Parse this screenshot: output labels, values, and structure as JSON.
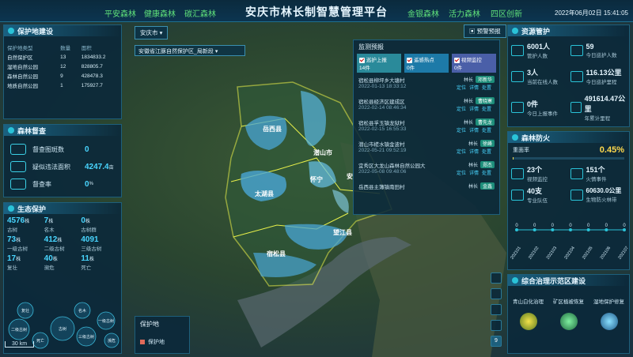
{
  "header": {
    "title": "安庆市林长制智慧管理平台",
    "nav_left": [
      "平安森林",
      "健康森林",
      "碳汇森林"
    ],
    "nav_right": [
      "金银森林",
      "活力森林",
      "四区创新"
    ],
    "clock": "2022年06月02日 15:41:05"
  },
  "map": {
    "city_select": "安庆市",
    "breadcrumb": "安徽省江豚自然保护区_局新段",
    "warning_button": "预警预报",
    "labels": {
      "yuexi": "岳西县",
      "qianshan": "潜山市",
      "taihu": "太湖县",
      "huaining": "怀宁",
      "susong": "宿松县",
      "wangjiang": "望江县",
      "aq": "安"
    },
    "scale": "30 km",
    "page_badge": "9"
  },
  "protect": {
    "title": "保护地建设",
    "headers": [
      "保护地类型",
      "数量",
      "面积"
    ],
    "rows": [
      [
        "自然保护区",
        "13",
        "1834833.2"
      ],
      [
        "湿地自然公园",
        "12",
        "828805.7"
      ],
      [
        "森林自然公园",
        "9",
        "428478.3"
      ],
      [
        "地质自然公园",
        "1",
        "175927.7"
      ]
    ]
  },
  "forest_check": {
    "title": "森林督查",
    "items": [
      {
        "label": "督查图斑数",
        "value": "0",
        "unit": ""
      },
      {
        "label": "疑似违法面积",
        "value": "4247.4",
        "unit": "亩"
      },
      {
        "label": "督查率",
        "value": "0",
        "unit": "%"
      }
    ]
  },
  "ecology": {
    "title": "生态保护",
    "stats": [
      {
        "value": "4576",
        "unit": "株",
        "label": "古树"
      },
      {
        "value": "7",
        "unit": "株",
        "label": "名木"
      },
      {
        "value": "0",
        "unit": "株",
        "label": "古树群"
      },
      {
        "value": "73",
        "unit": "株",
        "label": "一级古树"
      },
      {
        "value": "412",
        "unit": "株",
        "label": "二级古树"
      },
      {
        "value": "4091",
        "unit": "",
        "label": "三级古树"
      },
      {
        "value": "17",
        "unit": "株",
        "label": "复壮"
      },
      {
        "value": "40",
        "unit": "株",
        "label": "濒危"
      },
      {
        "value": "11",
        "unit": "株",
        "label": "死亡"
      }
    ],
    "bubbles": [
      "复壮",
      "名木",
      "二级古树",
      "古树",
      "一级古树",
      "三级古树",
      "濒危",
      "死亡"
    ]
  },
  "legend": {
    "title": "保护地",
    "item": "保护地"
  },
  "alerts": {
    "title": "监测预报",
    "filters": [
      {
        "label": "巡护上报",
        "count": "14件"
      },
      {
        "label": "遥感热点",
        "count": "0件"
      },
      {
        "label": "视频监控",
        "count": "0件"
      }
    ],
    "items": [
      {
        "place": "宿松县柳坪乡大塘村",
        "time": "2022-01-13 18:33:12",
        "role": "林长",
        "name": "邓新华"
      },
      {
        "place": "宿松县经济区建成区",
        "time": "2022-02-14 08:46:34",
        "role": "林长",
        "name": "曹晓寒"
      },
      {
        "place": "宿松县孚玉镇龙狱村",
        "time": "2022-02-15 16:55:33",
        "role": "林长",
        "name": "曹先龙"
      },
      {
        "place": "潜山市槎水镇金波村",
        "time": "2022-05-21 09:52:19",
        "role": "林长",
        "name": "徐峰"
      },
      {
        "place": "宜秀区大龙山森林自然公园大",
        "time": "2022-05-08 09:48:06",
        "role": "林长",
        "name": "郑杰"
      },
      {
        "place": "岳西县主簿镇南田村",
        "time": "",
        "role": "林长",
        "name": "金鑫"
      }
    ],
    "actions": [
      "定位",
      "详情",
      "处置"
    ]
  },
  "resources": {
    "title": "资源管护",
    "items": [
      {
        "value": "6001人",
        "label": "管护人数"
      },
      {
        "value": "59",
        "label": "今日巡护人数"
      },
      {
        "value": "3人",
        "label": "当前在线人数"
      },
      {
        "value": "116.13公里",
        "label": "今日巡护里程"
      },
      {
        "value": "0件",
        "label": "今日上报事件"
      },
      {
        "value": "491614.47公里",
        "label": "年累计里程"
      }
    ]
  },
  "fire": {
    "title": "森林防火",
    "rate_label": "重面率",
    "rate": "0.45%",
    "items": [
      {
        "value": "23个",
        "label": "视频监控"
      },
      {
        "value": "151个",
        "label": "火情事件"
      },
      {
        "value": "40支",
        "label": "专业队伍"
      },
      {
        "value": "60630.0公里",
        "label": "生物防火林带"
      }
    ],
    "chart_labels": [
      "0",
      "0",
      "0",
      "0",
      "0",
      "0",
      "0"
    ],
    "dates": [
      "202101",
      "202102",
      "202103",
      "202104",
      "202105",
      "202106",
      "202107"
    ]
  },
  "chart_data": {
    "type": "line",
    "categories": [
      "202101",
      "202102",
      "202103",
      "202104",
      "202105",
      "202106",
      "202107"
    ],
    "values": [
      0,
      0,
      0,
      0,
      0,
      0,
      0
    ]
  },
  "demo": {
    "title": "综合治理示范区建设",
    "items": [
      "青山白化治理",
      "矿区植被恢复",
      "湿地保护修复"
    ]
  },
  "colors": {
    "accent": "#2ac3d8",
    "nav": "#5fe07a",
    "highlight": "#ffd94d",
    "water": "#3a8fbf",
    "boundary": "#e8f04a"
  }
}
